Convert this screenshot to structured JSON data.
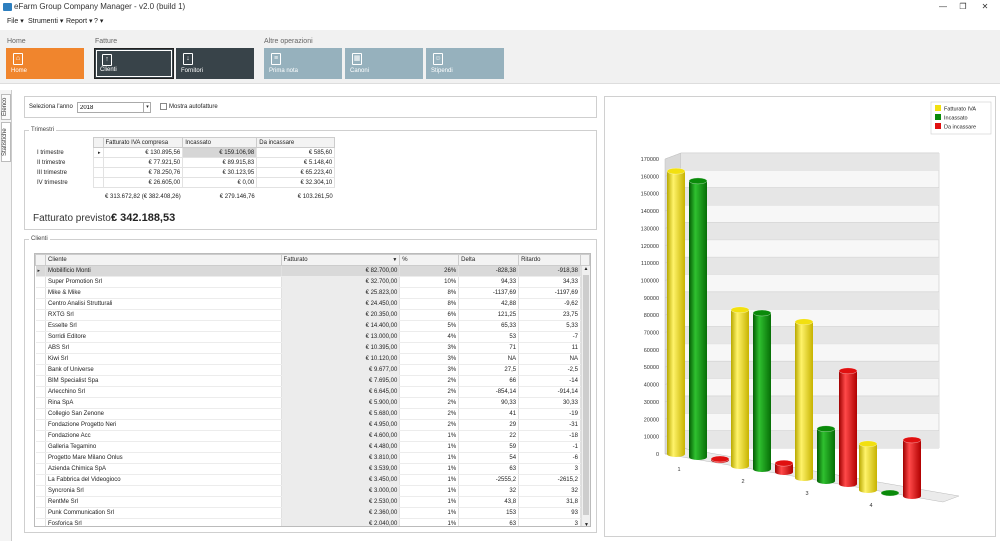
{
  "window": {
    "title": "eFarm Group Company Manager - v2.0 (build 1)"
  },
  "menu": [
    "File",
    "Strumenti",
    "Report",
    "?"
  ],
  "ribbon": {
    "groups": [
      "Home",
      "Fatture",
      "Altre operazioni"
    ],
    "buttons": [
      {
        "label": "Home",
        "icon": "home-icon",
        "color": "#f0852d"
      },
      {
        "label": "Clienti",
        "icon": "export-icon",
        "color": "#384349"
      },
      {
        "label": "Fornitori",
        "icon": "import-icon",
        "color": "#384349"
      },
      {
        "label": "Prima nota",
        "icon": "notes-icon",
        "color": "#96b1bd"
      },
      {
        "label": "Canoni",
        "icon": "calendar-icon",
        "color": "#96b1bd"
      },
      {
        "label": "Stipendi",
        "icon": "person-icon",
        "color": "#96b1bd"
      }
    ]
  },
  "side_tabs": [
    "Elenco",
    "Statistiche"
  ],
  "filters": {
    "year_label": "Seleziona l'anno",
    "year_value": "2018",
    "self_invoice_label": "Mostra autofatture"
  },
  "quarters": {
    "group_title": "Trimestri",
    "columns": [
      "Fatturato IVA compresa",
      "Incassato",
      "Da incassare"
    ],
    "rows": [
      {
        "label": "I trimestre",
        "fatturato": "€ 130.895,56",
        "incassato": "€ 159.106,98",
        "da_incassare": "€ 585,60"
      },
      {
        "label": "II trimestre",
        "fatturato": "€ 77.921,50",
        "incassato": "€ 89.915,83",
        "da_incassare": "€ 5.148,40"
      },
      {
        "label": "III trimestre",
        "fatturato": "€ 78.250,76",
        "incassato": "€ 30.123,95",
        "da_incassare": "€ 65.223,40"
      },
      {
        "label": "IV trimestre",
        "fatturato": "€ 26.605,00",
        "incassato": "€ 0,00",
        "da_incassare": "€ 32.304,10"
      }
    ],
    "totals": {
      "fatturato": "€ 313.672,82 (€ 382.408,26)",
      "incassato": "€ 279.146,76",
      "da_incassare": "€ 103.261,50"
    },
    "forecast_label": "Fatturato previsto:",
    "forecast_value": "€ 342.188,53"
  },
  "clients": {
    "group_title": "Clienti",
    "columns": [
      "Cliente",
      "Fatturato",
      "%",
      "Delta",
      "Ritardo"
    ],
    "rows": [
      [
        "Mobilificio Monti",
        "€ 82.700,00",
        "26%",
        "-828,38",
        "-918,38"
      ],
      [
        "Super Promotion Srl",
        "€ 32.700,00",
        "10%",
        "94,33",
        "34,33"
      ],
      [
        "Mike & Mike",
        "€ 25.823,00",
        "8%",
        "-1137,69",
        "-1197,69"
      ],
      [
        "Centro Analisi Strutturali",
        "€ 24.450,00",
        "8%",
        "42,88",
        "-9,62"
      ],
      [
        "RXTG Srl",
        "€ 20.350,00",
        "6%",
        "121,25",
        "23,75"
      ],
      [
        "Esselte Srl",
        "€ 14.400,00",
        "5%",
        "65,33",
        "5,33"
      ],
      [
        "Sorridi Editore",
        "€ 13.000,00",
        "4%",
        "53",
        "-7"
      ],
      [
        "ABS Srl",
        "€ 10.395,00",
        "3%",
        "71",
        "11"
      ],
      [
        "Kiwi Srl",
        "€ 10.120,00",
        "3%",
        "NA",
        "NA"
      ],
      [
        "Bank of Universe",
        "€ 9.677,00",
        "3%",
        "27,5",
        "-2,5"
      ],
      [
        "BIM Specialist Spa",
        "€ 7.695,00",
        "2%",
        "66",
        "-14"
      ],
      [
        "Arlecchino Srl",
        "€ 6.645,00",
        "2%",
        "-854,14",
        "-914,14"
      ],
      [
        "Rina SpA",
        "€ 5.900,00",
        "2%",
        "90,33",
        "30,33"
      ],
      [
        "Collegio San Zenone",
        "€ 5.680,00",
        "2%",
        "41",
        "-19"
      ],
      [
        "Fondazione Progetto Neri",
        "€ 4.950,00",
        "2%",
        "29",
        "-31"
      ],
      [
        "Fondazione Acc",
        "€ 4.600,00",
        "1%",
        "22",
        "-18"
      ],
      [
        "Galleria Tegamino",
        "€ 4.480,00",
        "1%",
        "59",
        "-1"
      ],
      [
        "Progetto Mare Milano Onlus",
        "€ 3.810,00",
        "1%",
        "54",
        "-6"
      ],
      [
        "Azienda Chimica SpA",
        "€ 3.539,00",
        "1%",
        "63",
        "3"
      ],
      [
        "La Fabbrica del Videogioco",
        "€ 3.450,00",
        "1%",
        "-2555,2",
        "-2615,2"
      ],
      [
        "Syncronia Srl",
        "€ 3.000,00",
        "1%",
        "32",
        "32"
      ],
      [
        "RentMe Srl",
        "€ 2.530,00",
        "1%",
        "43,8",
        "31,8"
      ],
      [
        "Punk Communication Srl",
        "€ 2.360,00",
        "1%",
        "153",
        "93"
      ],
      [
        "Fosforica Srl",
        "€ 2.040,00",
        "1%",
        "63",
        "3"
      ]
    ]
  },
  "chart_data": {
    "type": "bar",
    "categories": [
      "1",
      "2",
      "3",
      "4"
    ],
    "series": [
      {
        "name": "Fatturato IVA",
        "color": "#f2e010",
        "values": [
          163000,
          90000,
          90000,
          26600
        ]
      },
      {
        "name": "Incassato",
        "color": "#0a8a0a",
        "values": [
          159100,
          89900,
          30100,
          0
        ]
      },
      {
        "name": "Da incassare",
        "color": "#e01010",
        "values": [
          600,
          5100,
          65200,
          32300
        ]
      }
    ],
    "yticks": [
      "0",
      "10000",
      "20000",
      "30000",
      "40000",
      "50000",
      "60000",
      "70000",
      "80000",
      "90000",
      "100000",
      "110000",
      "120000",
      "130000",
      "140000",
      "150000",
      "160000",
      "170000"
    ],
    "ylim": [
      0,
      170000
    ],
    "legend": "top-right",
    "grid": true
  }
}
